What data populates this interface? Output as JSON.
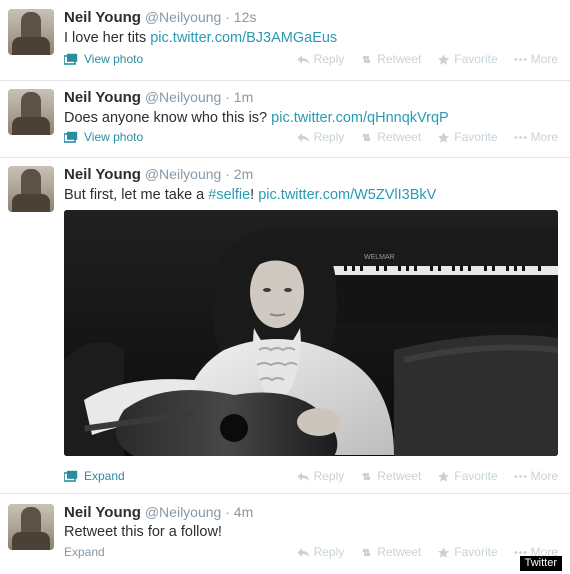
{
  "tweets": [
    {
      "name": "Neil Young",
      "handle": "@Neilyoung",
      "separator": "·",
      "time": "12s",
      "text": "I love her tits ",
      "link": "pic.twitter.com/BJ3AMGaEus",
      "expand_label": "View photo"
    },
    {
      "name": "Neil Young",
      "handle": "@Neilyoung",
      "separator": "·",
      "time": "1m",
      "text": "Does anyone know who this is? ",
      "link": "pic.twitter.com/qHnnqkVrqP",
      "expand_label": "View photo"
    },
    {
      "name": "Neil Young",
      "handle": "@Neilyoung",
      "separator": "·",
      "time": "2m",
      "text_pre": "But first, let me take a ",
      "hashtag": "#selfie",
      "text_post": "! ",
      "link": "pic.twitter.com/W5ZVlI3BkV",
      "piano_brand": "WELMAR",
      "expand_label": "Expand"
    },
    {
      "name": "Neil Young",
      "handle": "@Neilyoung",
      "separator": "·",
      "time": "4m",
      "text": "Retweet this for a follow!",
      "expand_label": "Expand"
    }
  ],
  "actions": {
    "reply": "Reply",
    "retweet": "Retweet",
    "favorite": "Favorite",
    "more": "More"
  },
  "source_badge": "Twitter",
  "colors": {
    "link": "#2a9ab3",
    "action_inactive": "#c8d2d8",
    "divider": "#e6e6e6"
  }
}
